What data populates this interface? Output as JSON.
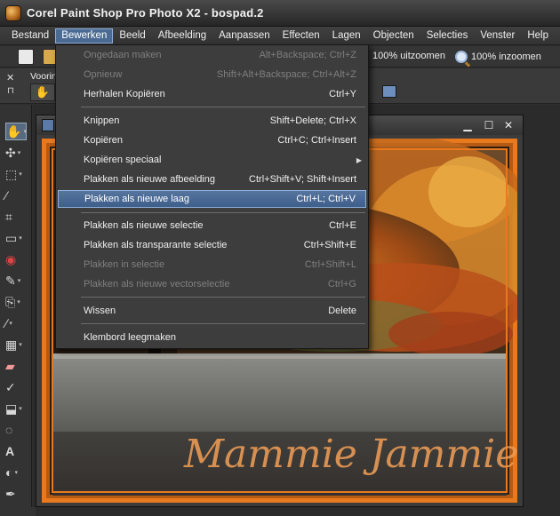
{
  "window": {
    "title": "Corel Paint Shop Pro Photo X2 - bospad.2"
  },
  "menubar": {
    "items": [
      "Bestand",
      "Bewerken",
      "Beeld",
      "Afbeelding",
      "Aanpassen",
      "Effecten",
      "Lagen",
      "Objecten",
      "Selecties",
      "Venster",
      "Help"
    ],
    "active_index": 1
  },
  "toolbar": {
    "zoom_out_label": "100% uitzoomen",
    "zoom_in_label": "100% inzoomen"
  },
  "options": {
    "label": "Voorins",
    "close_glyph": "✕",
    "pin_glyph": "⊓"
  },
  "edit_menu": {
    "items": [
      {
        "label": "Ongedaan maken",
        "shortcut": "Alt+Backspace; Ctrl+Z",
        "enabled": false
      },
      {
        "label": "Opnieuw",
        "shortcut": "Shift+Alt+Backspace; Ctrl+Alt+Z",
        "enabled": false
      },
      {
        "label": "Herhalen  Kopiëren",
        "shortcut": "Ctrl+Y",
        "enabled": true
      },
      {
        "label": "Knippen",
        "shortcut": "Shift+Delete; Ctrl+X",
        "enabled": true
      },
      {
        "label": "Kopiëren",
        "shortcut": "Ctrl+C; Ctrl+Insert",
        "enabled": true
      },
      {
        "label": "Kopiëren speciaal",
        "shortcut": "",
        "enabled": true,
        "submenu": true
      },
      {
        "label": "Plakken als nieuwe afbeelding",
        "shortcut": "Ctrl+Shift+V; Shift+Insert",
        "enabled": true
      },
      {
        "label": "Plakken als nieuwe laag",
        "shortcut": "Ctrl+L; Ctrl+V",
        "enabled": true,
        "highlighted": true
      },
      {
        "label": "Plakken als nieuwe selectie",
        "shortcut": "Ctrl+E",
        "enabled": true
      },
      {
        "label": "Plakken als transparante selectie",
        "shortcut": "Ctrl+Shift+E",
        "enabled": true
      },
      {
        "label": "Plakken in selectie",
        "shortcut": "Ctrl+Shift+L",
        "enabled": false
      },
      {
        "label": "Plakken als nieuwe vectorselectie",
        "shortcut": "Ctrl+G",
        "enabled": false
      },
      {
        "label": "Wissen",
        "shortcut": "Delete",
        "enabled": true
      },
      {
        "label": "Klembord leegmaken",
        "shortcut": "",
        "enabled": true
      }
    ]
  },
  "document": {
    "signature_text": "Mammie Jammie",
    "colors": {
      "frame_orange": "#e8791f",
      "signature": "#e89a55"
    }
  },
  "tools": [
    "pan-tool",
    "move-tool",
    "selection-tool",
    "dropper-tool",
    "crop-tool",
    "straighten-tool",
    "red-eye-tool",
    "makeover-tool",
    "clone-tool",
    "scratch-remover-tool",
    "paint-brush-tool",
    "dodge-tool",
    "eraser-tool",
    "flood-fill-tool",
    "picture-tube-tool",
    "text-tool",
    "preset-shape-tool",
    "pen-tool"
  ]
}
